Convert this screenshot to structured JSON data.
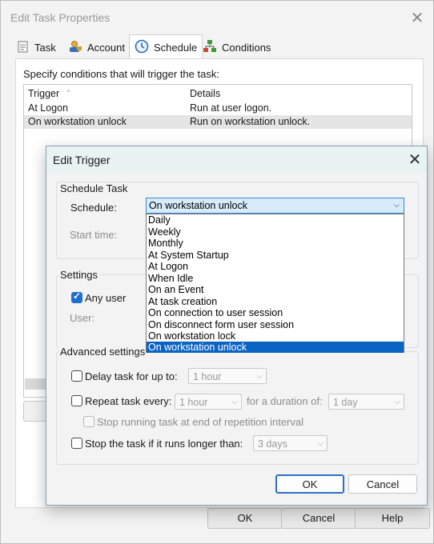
{
  "outer": {
    "title": "Edit Task Properties",
    "tabs": [
      {
        "label": "Task",
        "icon": "task-icon"
      },
      {
        "label": "Account",
        "icon": "account-icon"
      },
      {
        "label": "Schedule",
        "icon": "clock-icon"
      },
      {
        "label": "Conditions",
        "icon": "conditions-icon"
      }
    ],
    "selected_tab": "Schedule",
    "instruction": "Specify conditions that will trigger the task:",
    "columns": [
      "Trigger",
      "Details"
    ],
    "rows": [
      {
        "trigger": "At Logon",
        "details": "Run at user logon."
      },
      {
        "trigger": "On workstation unlock",
        "details": "Run on workstation unlock."
      }
    ],
    "buttons": {
      "ok": "OK",
      "cancel": "Cancel",
      "help": "Help"
    }
  },
  "dialog": {
    "title": "Edit Trigger",
    "schedule_group": {
      "label": "Schedule Task",
      "schedule_label": "Schedule:",
      "schedule_value": "On workstation unlock",
      "start_time_label": "Start time:",
      "options": [
        "Daily",
        "Weekly",
        "Monthly",
        "At System Startup",
        "At Logon",
        "When Idle",
        "On an Event",
        "At task creation",
        "On connection to user session",
        "On disconnect form user session",
        "On workstation lock",
        "On workstation unlock"
      ]
    },
    "settings_group": {
      "label": "Settings",
      "any_user_label": "Any user",
      "any_user_checked": true,
      "user_label": "User:"
    },
    "advanced_group": {
      "label": "Advanced settings",
      "delay_label": "Delay task for up to:",
      "delay_value": "1 hour",
      "repeat_label": "Repeat task every:",
      "repeat_value": "1 hour",
      "duration_label": "for a duration of:",
      "duration_value": "1 day",
      "stop_repetition_label": "Stop running task at end of repetition interval",
      "stop_longer_label": "Stop the task if it runs longer than:",
      "stop_longer_value": "3 days"
    },
    "buttons": {
      "ok": "OK",
      "cancel": "Cancel"
    }
  },
  "colors": {
    "selection": "#0b64c4",
    "accent": "#1f6fd1",
    "dialog_titlebar": "#e9f3f2"
  }
}
